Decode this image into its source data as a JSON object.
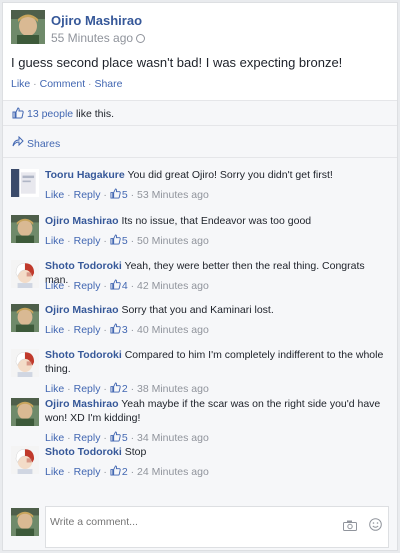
{
  "post": {
    "author": "Ojiro Mashirao",
    "time": "55 Minutes ago",
    "text": "I guess second place wasn't bad! I was expecting bronze!",
    "actions": {
      "like": "Like",
      "comment": "Comment",
      "share": "Share",
      "sep": " · "
    }
  },
  "likes": {
    "count_link": "13 people",
    "suffix": " like this."
  },
  "shares": {
    "label": "Shares"
  },
  "comments": [
    {
      "author": "Tooru Hagakure",
      "text": "You did great Ojiro! Sorry you didn't get first!",
      "likes": "5",
      "time": "53 Minutes ago",
      "avatar": "avatar-tooru"
    },
    {
      "author": "Ojiro Mashirao",
      "text": "Its no issue, that Endeavor was too good",
      "likes": "5",
      "time": "50 Minutes ago",
      "avatar": "avatar-ojiro"
    },
    {
      "author": "Shoto Todoroki",
      "text": "Yeah, they were better then the real thing. Congrats man.",
      "likes": "4",
      "time": "42 Minutes ago",
      "avatar": "avatar-shoto"
    },
    {
      "author": "Ojiro Mashirao",
      "text": "Sorry that you and Kaminari lost.",
      "likes": "3",
      "time": "40 Minutes ago",
      "avatar": "avatar-ojiro"
    },
    {
      "author": "Shoto Todoroki",
      "text": "Compared to him I'm completely indifferent to the whole thing.",
      "likes": "2",
      "time": "38 Minutes ago",
      "avatar": "avatar-shoto"
    },
    {
      "author": "Ojiro Mashirao",
      "text": "Yeah maybe if the scar was on the right side you'd have won! XD I'm kidding!",
      "likes": "5",
      "time": "34 Minutes ago",
      "avatar": "avatar-ojiro"
    },
    {
      "author": "Shoto Todoroki",
      "text": "Stop",
      "likes": "2",
      "time": "24 Minutes ago",
      "avatar": "avatar-shoto"
    }
  ],
  "comment_actions": {
    "like": "Like",
    "reply": "Reply",
    "sep": " · "
  },
  "compose": {
    "placeholder": "Write a comment..."
  },
  "colors": {
    "link": "#4267b2",
    "name": "#365899",
    "muted": "#90949c",
    "panel": "#f6f7f9"
  }
}
